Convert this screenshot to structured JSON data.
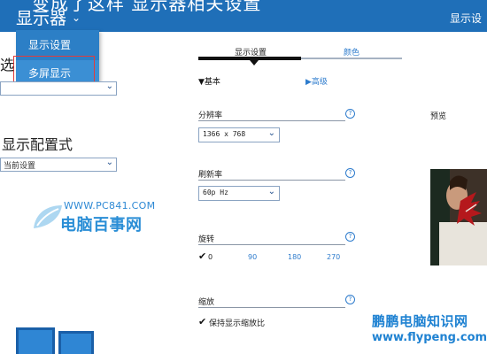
{
  "header": {
    "partial_title": "变成了这样 显示器相关设置",
    "title": "显示器",
    "right_partial": "显示设"
  },
  "menu": {
    "items": [
      "显示设置",
      "多屏显示"
    ]
  },
  "left": {
    "partial_section": "选",
    "select1_partial": "",
    "section2_title": "显示配置式",
    "select2_value": "当前设置"
  },
  "tabs": {
    "display": "显示设置",
    "color": "颜色"
  },
  "modes": {
    "basic": "▼基本",
    "advanced": "▶高级"
  },
  "resolution": {
    "label": "分辨率",
    "value": "1366 x 768"
  },
  "refresh": {
    "label": "刷新率",
    "value": "60p Hz"
  },
  "rotation": {
    "label": "旋转",
    "options": [
      "0",
      "90",
      "180",
      "270"
    ],
    "checkmark": "✔"
  },
  "scale": {
    "label": "缩放",
    "checkmark": "✔",
    "option": "保持显示缩放比"
  },
  "preview": {
    "label": "预览"
  },
  "help_glyph": "?",
  "watermark_top": {
    "url": "WWW.PC841.COM",
    "name": "电脑百事网"
  },
  "watermark_bottom": {
    "name": "鹏鹏电脑知识网",
    "url": "www.flypeng.com"
  },
  "colors": {
    "header_blue": "#1f6fb8",
    "menu_blue": "#2c7fc6",
    "link_blue": "#2e7ccd",
    "highlight_red": "#e23b3b"
  }
}
